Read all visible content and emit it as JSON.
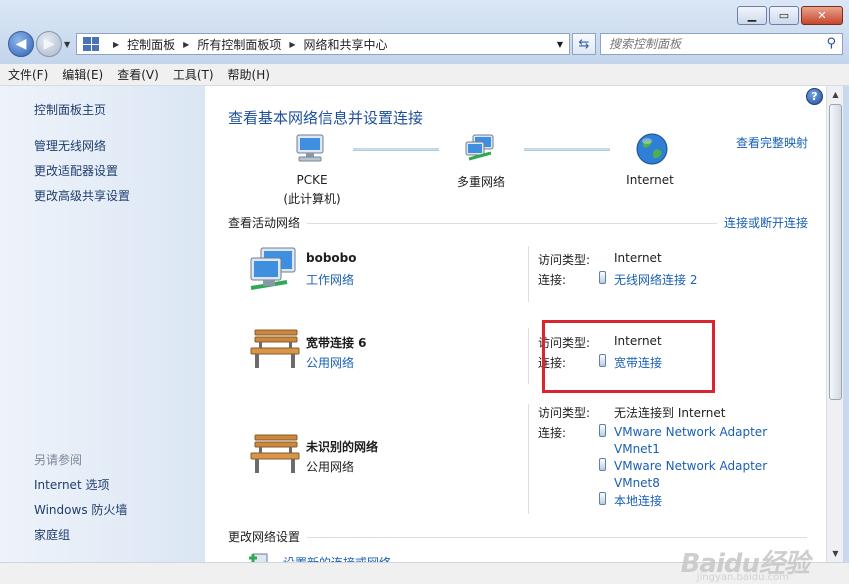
{
  "breadcrumb": [
    "控制面板",
    "所有控制面板项",
    "网络和共享中心"
  ],
  "search": {
    "placeholder": "搜索控制面板"
  },
  "menu": [
    "文件(F)",
    "编辑(E)",
    "查看(V)",
    "工具(T)",
    "帮助(H)"
  ],
  "sidebar": {
    "home": "控制面板主页",
    "links": [
      "管理无线网络",
      "更改适配器设置",
      "更改高级共享设置"
    ],
    "see_also_title": "另请参阅",
    "see_also": [
      "Internet 选项",
      "Windows 防火墙",
      "家庭组"
    ]
  },
  "main": {
    "title": "查看基本网络信息并设置连接",
    "full_map_link": "查看完整映射",
    "map_nodes": [
      {
        "line1": "PCKE",
        "line2": "(此计算机)"
      },
      {
        "line1": "多重网络",
        "line2": ""
      },
      {
        "line1": "Internet",
        "line2": ""
      }
    ],
    "active_section": "查看活动网络",
    "connect_link": "连接或断开连接",
    "networks": [
      {
        "name": "bobobo",
        "category": "工作网络",
        "access_label": "访问类型:",
        "access": "Internet",
        "conn_label": "连接:",
        "connections": [
          "无线网络连接 2"
        ]
      },
      {
        "name": "宽带连接  6",
        "category": "公用网络",
        "access_label": "访问类型:",
        "access": "Internet",
        "conn_label": "连接:",
        "connections": [
          "宽带连接"
        ]
      },
      {
        "name": "未识别的网络",
        "category": "公用网络",
        "access_label": "访问类型:",
        "access": "无法连接到 Internet",
        "conn_label": "连接:",
        "connections": [
          "VMware Network Adapter VMnet1",
          "VMware Network Adapter VMnet8",
          "本地连接"
        ]
      }
    ],
    "change_section": "更改网络设置",
    "setup_link": "设置新的连接或网络"
  },
  "watermark": {
    "brand": "Baidu经验",
    "url": "jingyan.baidu.com"
  },
  "colors": {
    "link": "#1a5fb4",
    "title": "#1e4f9b",
    "highlight": "#d8262f"
  }
}
